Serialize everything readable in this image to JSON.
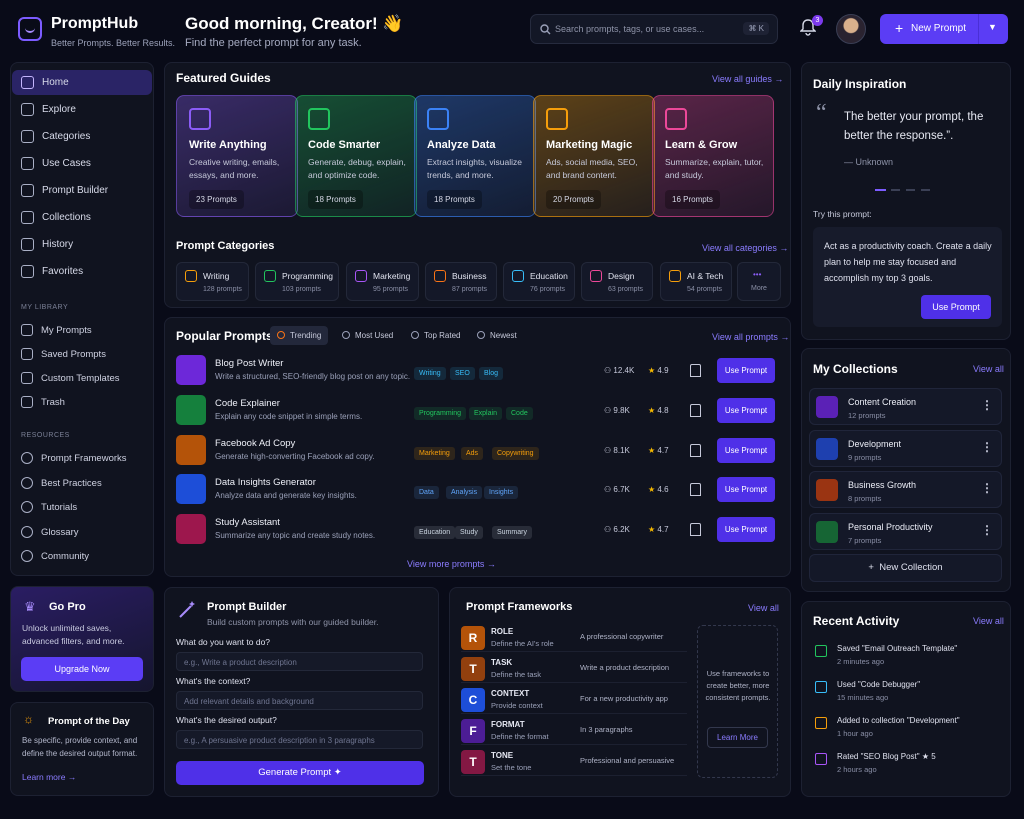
{
  "app": {
    "name": "PromptHub",
    "tagline": "Better Prompts. Better Results."
  },
  "header": {
    "greeting": "Good morning, Creator! 👋",
    "subtitle": "Find the perfect prompt for any task.",
    "search_placeholder": "Search prompts, tags, or use cases...",
    "search_shortcut": "⌘ K",
    "notifications": "3",
    "new_prompt": "New Prompt"
  },
  "nav": [
    {
      "label": "Home",
      "icon": "home-icon"
    },
    {
      "label": "Explore",
      "icon": "compass-icon"
    },
    {
      "label": "Categories",
      "icon": "grid-icon"
    },
    {
      "label": "Use Cases",
      "icon": "target-icon"
    },
    {
      "label": "Prompt Builder",
      "icon": "builder-icon"
    },
    {
      "label": "Collections",
      "icon": "folder-icon"
    },
    {
      "label": "History",
      "icon": "clock-icon"
    },
    {
      "label": "Favorites",
      "icon": "star-icon"
    }
  ],
  "library": {
    "title": "MY LIBRARY",
    "items": [
      "My Prompts",
      "Saved Prompts",
      "Custom Templates",
      "Trash"
    ]
  },
  "resources": {
    "title": "RESOURCES",
    "items": [
      "Prompt Frameworks",
      "Best Practices",
      "Tutorials",
      "Glossary",
      "Community"
    ]
  },
  "gopro": {
    "title": "Go Pro",
    "text": "Unlock unlimited saves, advanced filters, and more.",
    "button": "Upgrade Now"
  },
  "potd": {
    "title": "Prompt of the Day",
    "text": "Be specific, provide context, and define the desired output format.",
    "link": "Learn more →"
  },
  "featured": {
    "title": "Featured Guides",
    "link": "View all guides →",
    "cards": [
      {
        "title": "Write Anything",
        "desc": "Creative writing, emails, essays, and more.",
        "count": "23 Prompts",
        "color": "#8b5cf6"
      },
      {
        "title": "Code Smarter",
        "desc": "Generate, debug, explain, and optimize code.",
        "count": "18 Prompts",
        "color": "#22c55e"
      },
      {
        "title": "Analyze Data",
        "desc": "Extract insights, visualize trends, and more.",
        "count": "18 Prompts",
        "color": "#3b82f6"
      },
      {
        "title": "Marketing Magic",
        "desc": "Ads, social media, SEO, and brand content.",
        "count": "20 Prompts",
        "color": "#f59e0b"
      },
      {
        "title": "Learn & Grow",
        "desc": "Summarize, explain, tutor, and study.",
        "count": "16 Prompts",
        "color": "#ec4899"
      }
    ]
  },
  "categories": {
    "title": "Prompt Categories",
    "link": "View all categories →",
    "items": [
      {
        "name": "Writing",
        "count": "128 prompts",
        "color": "#f59e0b"
      },
      {
        "name": "Programming",
        "count": "103 prompts",
        "color": "#22c55e"
      },
      {
        "name": "Marketing",
        "count": "95 prompts",
        "color": "#a855f7"
      },
      {
        "name": "Business",
        "count": "87 prompts",
        "color": "#f97316"
      },
      {
        "name": "Education",
        "count": "76 prompts",
        "color": "#38bdf8"
      },
      {
        "name": "Design",
        "count": "63 prompts",
        "color": "#ec4899"
      },
      {
        "name": "AI & Tech",
        "count": "54 prompts",
        "color": "#f59e0b"
      },
      {
        "name": "More",
        "count": "",
        "color": "#8b5cf6"
      }
    ]
  },
  "popular": {
    "title": "Popular Prompts",
    "tabs": [
      "Trending",
      "Most Used",
      "Top Rated",
      "Newest"
    ],
    "link": "View all prompts →",
    "more": "View more prompts →",
    "use": "Use Prompt",
    "rows": [
      {
        "title": "Blog Post Writer",
        "desc": "Write a structured, SEO-friendly blog post on any topic.",
        "tags": [
          "Writing",
          "SEO",
          "Blog"
        ],
        "users": "12.4K",
        "rating": "4.9",
        "color": "#6d28d9",
        "tagColor": "#38bdf8"
      },
      {
        "title": "Code Explainer",
        "desc": "Explain any code snippet in simple terms.",
        "tags": [
          "Programming",
          "Explain",
          "Code"
        ],
        "users": "9.8K",
        "rating": "4.8",
        "color": "#15803d",
        "tagColor": "#22c55e"
      },
      {
        "title": "Facebook Ad Copy",
        "desc": "Generate high-converting Facebook ad copy.",
        "tags": [
          "Marketing",
          "Ads",
          "Copywriting"
        ],
        "users": "8.1K",
        "rating": "4.7",
        "color": "#b45309",
        "tagColor": "#f59e0b"
      },
      {
        "title": "Data Insights Generator",
        "desc": "Analyze data and generate key insights.",
        "tags": [
          "Data",
          "Analysis",
          "Insights"
        ],
        "users": "6.7K",
        "rating": "4.6",
        "color": "#1d4ed8",
        "tagColor": "#60a5fa"
      },
      {
        "title": "Study Assistant",
        "desc": "Summarize any topic and create study notes.",
        "tags": [
          "Education",
          "Study",
          "Summary"
        ],
        "users": "6.2K",
        "rating": "4.7",
        "color": "#9d174d",
        "tagColor": "#cbd5e1"
      }
    ]
  },
  "builder": {
    "title": "Prompt Builder",
    "subtitle": "Build custom prompts with our guided builder.",
    "fields": [
      {
        "label": "What do you want to do?",
        "placeholder": "e.g., Write a product description"
      },
      {
        "label": "What's the context?",
        "placeholder": "Add relevant details and background"
      },
      {
        "label": "What's the desired output?",
        "placeholder": "e.g., A persuasive product description in 3 paragraphs"
      }
    ],
    "button": "Generate Prompt"
  },
  "frameworks": {
    "title": "Prompt Frameworks",
    "link": "View all",
    "items": [
      {
        "letter": "R",
        "key": "ROLE",
        "desc": "Define the AI's role",
        "example": "A professional copywriter",
        "color": "#b45309"
      },
      {
        "letter": "T",
        "key": "TASK",
        "desc": "Define the task",
        "example": "Write a product description",
        "color": "#92400e"
      },
      {
        "letter": "C",
        "key": "CONTEXT",
        "desc": "Provide context",
        "example": "For a new productivity app",
        "color": "#1d4ed8"
      },
      {
        "letter": "F",
        "key": "FORMAT",
        "desc": "Define the format",
        "example": "In 3 paragraphs",
        "color": "#4c1d95"
      },
      {
        "letter": "T",
        "key": "TONE",
        "desc": "Set the tone",
        "example": "Professional and persuasive",
        "color": "#831843"
      }
    ],
    "note": "Use frameworks to create better, more consistent prompts.",
    "button": "Learn More"
  },
  "inspiration": {
    "title": "Daily Inspiration",
    "quote": "The better your prompt, the better the response.”.",
    "author": "— Unknown",
    "try_label": "Try this prompt:",
    "try_text": "Act as a productivity coach. Create a daily plan to help me stay focused and accomplish my top 3 goals.",
    "button": "Use Prompt"
  },
  "collections": {
    "title": "My Collections",
    "link": "View all",
    "items": [
      {
        "name": "Content Creation",
        "count": "12 prompts",
        "color": "#5b21b6"
      },
      {
        "name": "Development",
        "count": "9 prompts",
        "color": "#1e40af"
      },
      {
        "name": "Business Growth",
        "count": "8 prompts",
        "color": "#9a3412"
      },
      {
        "name": "Personal Productivity",
        "count": "7 prompts",
        "color": "#166534"
      }
    ],
    "new": "New Collection"
  },
  "activity": {
    "title": "Recent Activity",
    "link": "View all",
    "items": [
      {
        "text": "Saved \"Email Outreach Template\"",
        "when": "2 minutes ago",
        "color": "#22c55e"
      },
      {
        "text": "Used \"Code Debugger\"",
        "when": "15 minutes ago",
        "color": "#38bdf8"
      },
      {
        "text": "Added to collection \"Development\"",
        "when": "1 hour ago",
        "color": "#f59e0b"
      },
      {
        "text": "Rated \"SEO Blog Post\"  ★  5",
        "when": "2 hours ago",
        "color": "#a855f7"
      }
    ]
  }
}
